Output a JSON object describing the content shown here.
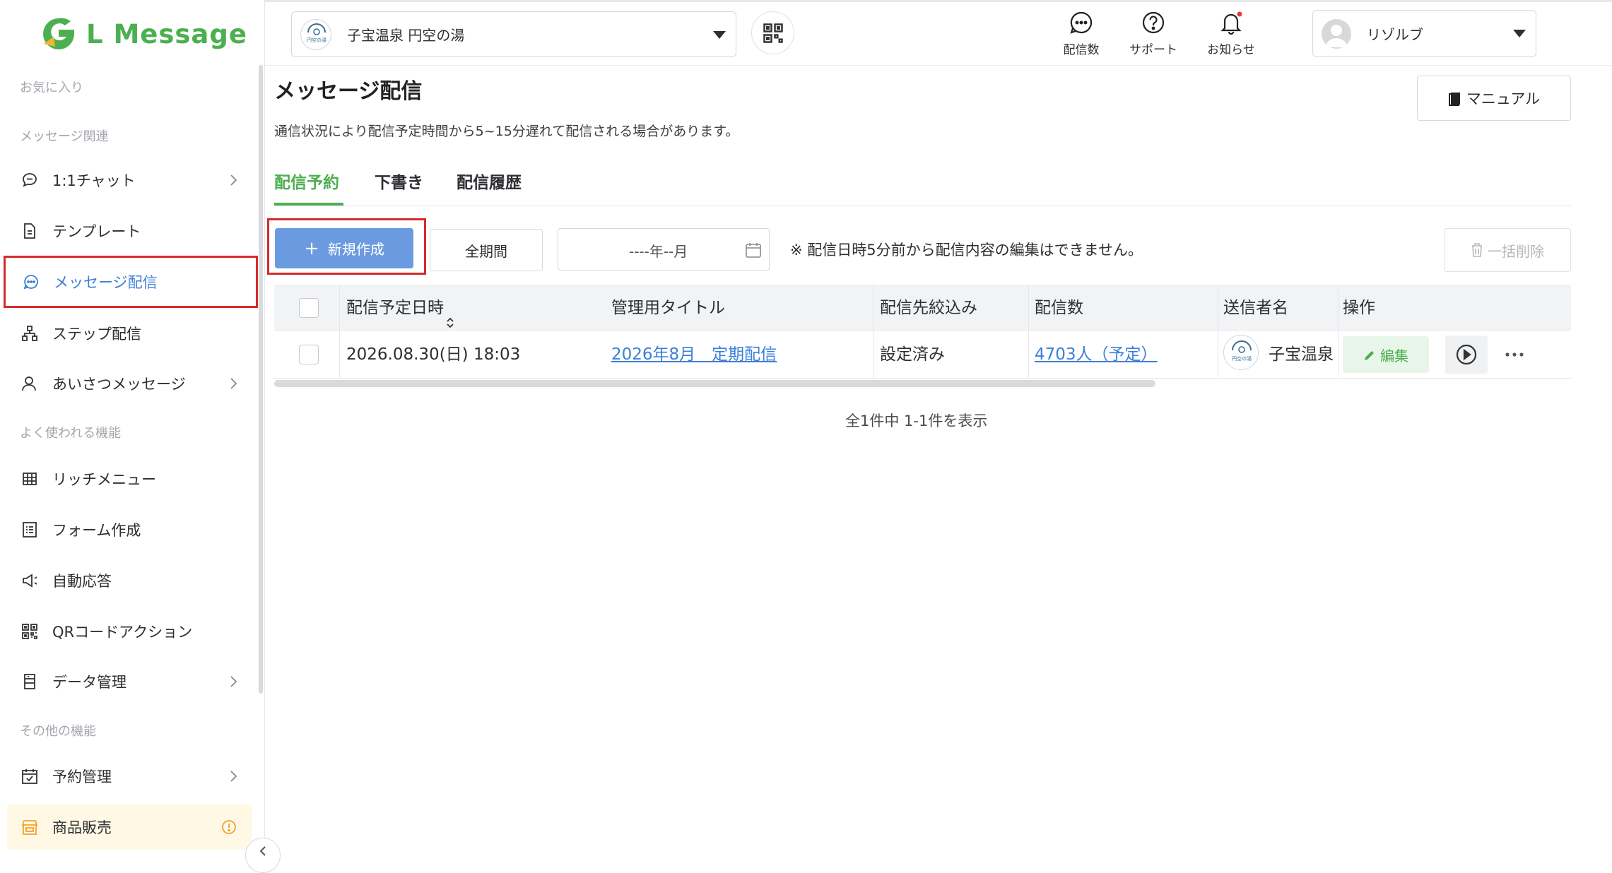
{
  "app": {
    "name": "L Message",
    "brand_color": "#4caf50",
    "accent_color": "#3c7fd8",
    "highlight_color": "#d52b2b"
  },
  "sidebar": {
    "sections": {
      "favorites": "お気に入り",
      "message": "メッセージ関連",
      "common": "よく使われる機能",
      "other": "その他の機能"
    },
    "items": [
      {
        "label": "1:1チャット",
        "icon": "chat-bubble-icon",
        "has_submenu": true
      },
      {
        "label": "テンプレート",
        "icon": "document-icon",
        "has_submenu": false
      },
      {
        "label": "メッセージ配信",
        "icon": "message-icon",
        "active": true
      },
      {
        "label": "ステップ配信",
        "icon": "step-icon",
        "has_submenu": false
      },
      {
        "label": "あいさつメッセージ",
        "icon": "user-icon",
        "has_submenu": true
      },
      {
        "label": "リッチメニュー",
        "icon": "grid-icon",
        "has_submenu": false
      },
      {
        "label": "フォーム作成",
        "icon": "form-icon",
        "has_submenu": false
      },
      {
        "label": "自動応答",
        "icon": "megaphone-icon",
        "has_submenu": false
      },
      {
        "label": "QRコードアクション",
        "icon": "qr-icon",
        "has_submenu": false
      },
      {
        "label": "データ管理",
        "icon": "database-icon",
        "has_submenu": true
      },
      {
        "label": "予約管理",
        "icon": "calendar-icon",
        "has_submenu": true
      },
      {
        "label": "商品販売",
        "icon": "shop-icon",
        "has_badge": true
      }
    ]
  },
  "topbar": {
    "store_name": "子宝温泉 円空の湯",
    "icons": [
      {
        "label": "配信数",
        "icon": "chat-dots-icon"
      },
      {
        "label": "サポート",
        "icon": "help-icon"
      },
      {
        "label": "お知らせ",
        "icon": "bell-icon",
        "has_dot": true
      }
    ],
    "user_name": "リゾルブ"
  },
  "main": {
    "title": "メッセージ配信",
    "note": "通信状況により配信予定時間から5~15分遅れて配信される場合があります。",
    "manual_label": "マニュアル",
    "tabs": [
      "配信予約",
      "下書き",
      "配信履歴"
    ],
    "active_tab": 0,
    "toolbar": {
      "new_label": "新規作成",
      "period_label": "全期間",
      "month_value": "----年--月",
      "edit_note": "※ 配信日時5分前から配信内容の編集はできません。",
      "bulk_delete_label": "一括削除"
    },
    "table": {
      "headers": [
        "配信予定日時",
        "管理用タイトル",
        "配信先絞込み",
        "配信数",
        "送信者名",
        "操作"
      ],
      "rows": [
        {
          "datetime": "2026.08.30(日) 18:03",
          "title": "2026年8月　定期配信",
          "filter": "設定済み",
          "count": "4703人（予定）",
          "sender": "子宝温泉",
          "edit_label": "編集"
        }
      ]
    },
    "pagination_text": "全1件中 1-1件を表示"
  }
}
